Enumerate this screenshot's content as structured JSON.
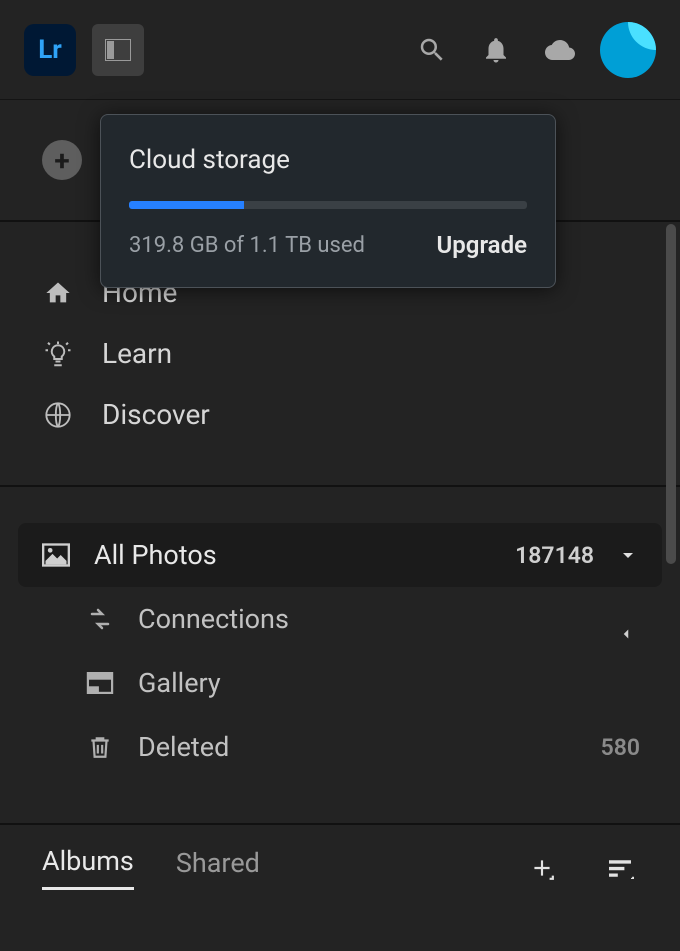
{
  "logo_text": "Lr",
  "add_photos_label": "Add Photos",
  "popover": {
    "title": "Cloud storage",
    "usage": "319.8 GB of 1.1 TB used",
    "upgrade": "Upgrade",
    "progress_pct": "29%"
  },
  "nav": {
    "home": "Home",
    "learn": "Learn",
    "discover": "Discover"
  },
  "photos": {
    "all_label": "All Photos",
    "all_count": "187148",
    "connections": "Connections",
    "gallery": "Gallery",
    "deleted": "Deleted",
    "deleted_count": "580"
  },
  "tabs": {
    "albums": "Albums",
    "shared": "Shared"
  }
}
